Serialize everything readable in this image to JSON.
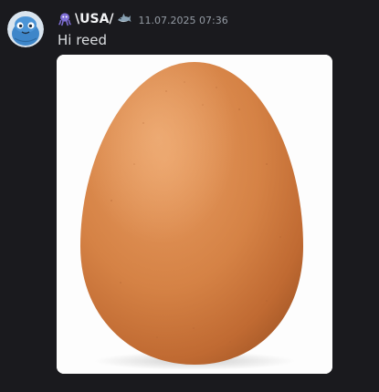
{
  "message": {
    "author": {
      "name": "\\USA/",
      "prefix_emoji": "octopus-icon",
      "suffix_emoji": "shark-icon",
      "avatar": "blue-blob-avatar"
    },
    "timestamp": "11.07.2025 07:36",
    "text": "Hi reed",
    "attachment": {
      "type": "image",
      "subject": "egg-image"
    }
  },
  "colors": {
    "background": "#1a1a1e",
    "username": "#f2f3f5",
    "text": "#dbdee1",
    "timestamp": "#949ba4"
  }
}
